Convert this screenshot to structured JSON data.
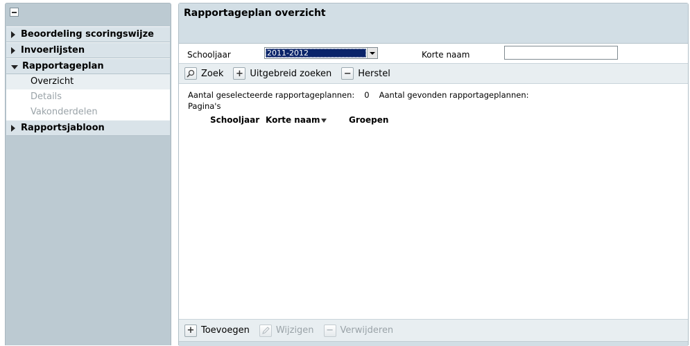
{
  "sidebar": {
    "items": [
      {
        "label": "Beoordeling scoringswijze",
        "expanded": false
      },
      {
        "label": "Invoerlijsten",
        "expanded": false
      },
      {
        "label": "Rapportageplan",
        "expanded": true,
        "children": [
          {
            "label": "Overzicht",
            "state": "active"
          },
          {
            "label": "Details",
            "state": "disabled"
          },
          {
            "label": "Vakonderdelen",
            "state": "disabled"
          }
        ]
      },
      {
        "label": "Rapportsjabloon",
        "expanded": false
      }
    ]
  },
  "main": {
    "title": "Rapportageplan overzicht",
    "filters": {
      "schooljaar_label": "Schooljaar",
      "schooljaar_value": "2011-2012",
      "korte_naam_label": "Korte naam",
      "korte_naam_value": ""
    },
    "toolbar": {
      "zoek": "Zoek",
      "uitgebreid_zoeken": "Uitgebreid zoeken",
      "herstel": "Herstel"
    },
    "results": {
      "selected_label": "Aantal geselecteerde rapportageplannen:",
      "selected_count": "0",
      "found_label": "Aantal gevonden rapportageplannen:",
      "found_count": "",
      "pages_label": "Pagina's"
    },
    "table": {
      "columns": [
        "Schooljaar",
        "Korte naam",
        "Groepen"
      ],
      "sorted_column": "Korte naam",
      "rows": []
    },
    "actions": {
      "toevoegen": "Toevoegen",
      "wijzigen": "Wijzigen",
      "verwijderen": "Verwijderen"
    }
  }
}
